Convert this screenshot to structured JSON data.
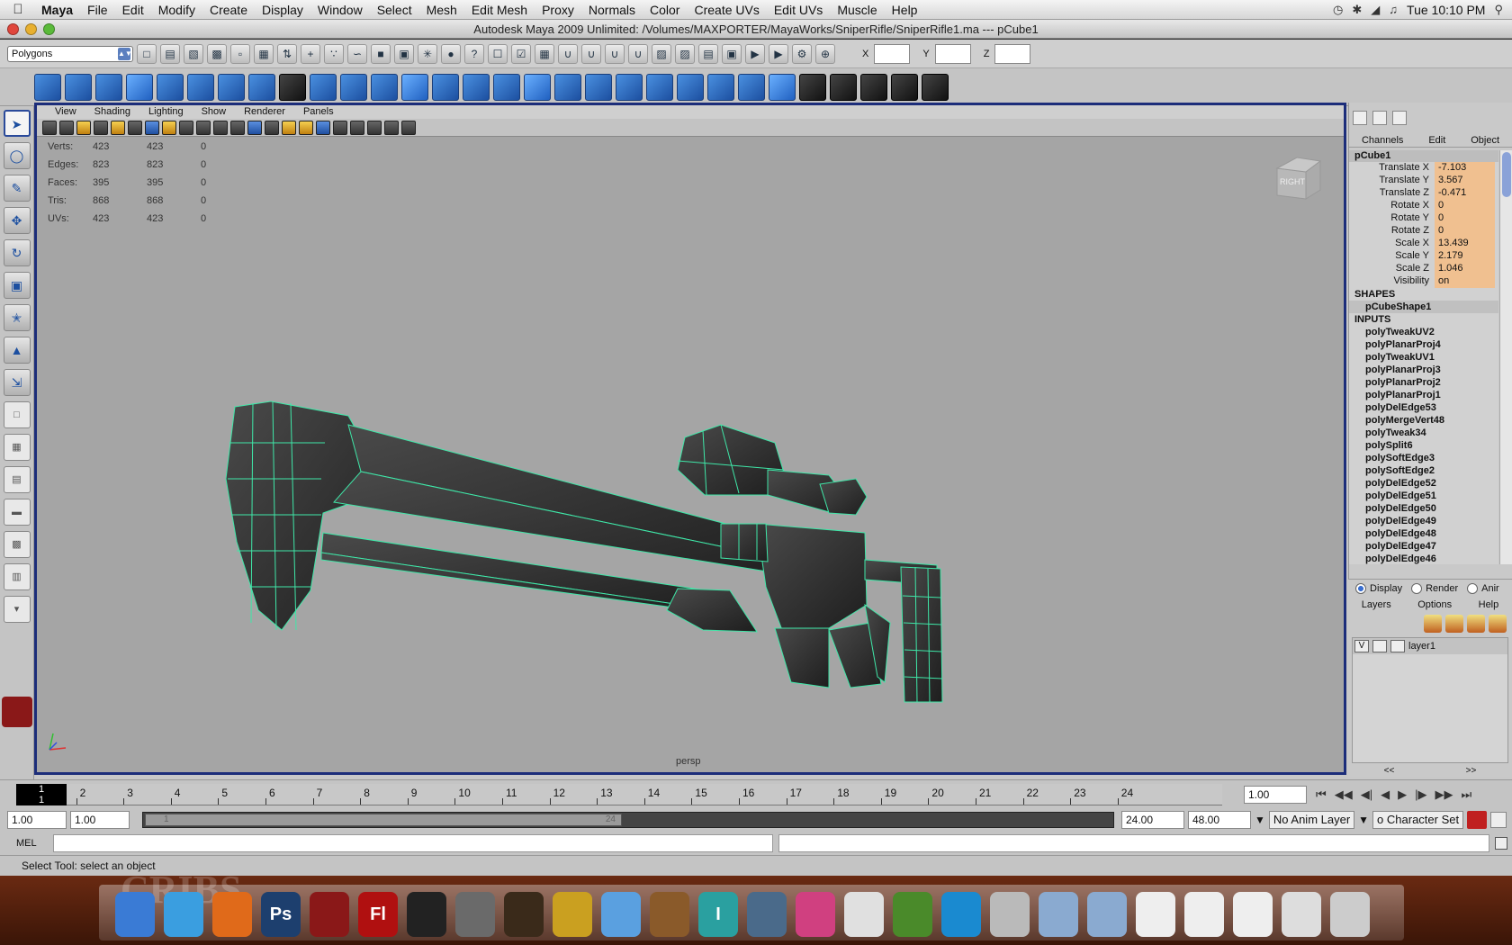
{
  "menubar": {
    "app": "Maya",
    "items": [
      "File",
      "Edit",
      "Modify",
      "Create",
      "Display",
      "Window",
      "Select",
      "Mesh",
      "Edit Mesh",
      "Proxy",
      "Normals",
      "Color",
      "Create UVs",
      "Edit UVs",
      "Muscle",
      "Help"
    ],
    "clock": "Tue 10:10 PM"
  },
  "window": {
    "title": "Autodesk Maya 2009 Unlimited: /Volumes/MAXPORTER/MayaWorks/SniperRifle/SniperRifle1.ma  ---  pCube1"
  },
  "shelf": {
    "mode": "Polygons",
    "x_label": "X",
    "y_label": "Y",
    "z_label": "Z"
  },
  "panel": {
    "menus": [
      "View",
      "Shading",
      "Lighting",
      "Show",
      "Renderer",
      "Panels"
    ],
    "camera": "persp",
    "viewcube_face": "RIGHT"
  },
  "hud": {
    "rows": [
      {
        "label": "Verts:",
        "a": "423",
        "b": "423",
        "c": "0"
      },
      {
        "label": "Edges:",
        "a": "823",
        "b": "823",
        "c": "0"
      },
      {
        "label": "Faces:",
        "a": "395",
        "b": "395",
        "c": "0"
      },
      {
        "label": "Tris:",
        "a": "868",
        "b": "868",
        "c": "0"
      },
      {
        "label": "UVs:",
        "a": "423",
        "b": "423",
        "c": "0"
      }
    ]
  },
  "channelbox": {
    "tabs": [
      "Channels",
      "Edit",
      "Object"
    ],
    "node": "pCube1",
    "attrs": [
      {
        "name": "Translate X",
        "value": "-7.103"
      },
      {
        "name": "Translate Y",
        "value": "3.567"
      },
      {
        "name": "Translate Z",
        "value": "-0.471"
      },
      {
        "name": "Rotate X",
        "value": "0"
      },
      {
        "name": "Rotate Y",
        "value": "0"
      },
      {
        "name": "Rotate Z",
        "value": "0"
      },
      {
        "name": "Scale X",
        "value": "13.439"
      },
      {
        "name": "Scale Y",
        "value": "2.179"
      },
      {
        "name": "Scale Z",
        "value": "1.046"
      },
      {
        "name": "Visibility",
        "value": "on"
      }
    ],
    "shapes_label": "SHAPES",
    "shape": "pCubeShape1",
    "inputs_label": "INPUTS",
    "inputs": [
      "polyTweakUV2",
      "polyPlanarProj4",
      "polyTweakUV1",
      "polyPlanarProj3",
      "polyPlanarProj2",
      "polyPlanarProj1",
      "polyDelEdge53",
      "polyMergeVert48",
      "polyTweak34",
      "polySplit6",
      "polySoftEdge3",
      "polySoftEdge2",
      "polyDelEdge52",
      "polyDelEdge51",
      "polyDelEdge50",
      "polyDelEdge49",
      "polyDelEdge48",
      "polyDelEdge47",
      "polyDelEdge46"
    ]
  },
  "layers": {
    "radio": [
      "Display",
      "Render",
      "Anir"
    ],
    "menus": [
      "Layers",
      "Options",
      "Help"
    ],
    "layer_name": "layer1",
    "vis": "V",
    "nav_left": "<<",
    "nav_right": ">>"
  },
  "time": {
    "current": "1",
    "ticks": [
      "1",
      "2",
      "3",
      "4",
      "5",
      "6",
      "7",
      "8",
      "9",
      "10",
      "11",
      "12",
      "13",
      "14",
      "15",
      "16",
      "17",
      "18",
      "19",
      "20",
      "21",
      "22",
      "23",
      "24"
    ],
    "current_field": "1.00",
    "start": "1.00",
    "start2": "1.00",
    "range_start": "1",
    "range_end": "24",
    "end": "24.00",
    "end2": "48.00",
    "anim_layer": "No Anim Layer",
    "char_set": "o Character Set"
  },
  "cmd": {
    "label": "MEL"
  },
  "help": {
    "text": "Select Tool: select an object"
  },
  "dock": {
    "bg_text": "CRIBS",
    "icons": [
      {
        "name": "finder",
        "label": "",
        "color": "#3a7bd5"
      },
      {
        "name": "safari",
        "label": "",
        "color": "#3a9ee0"
      },
      {
        "name": "firefox",
        "label": "",
        "color": "#e06a1a"
      },
      {
        "name": "photoshop",
        "label": "Ps",
        "color": "#1d3f6e"
      },
      {
        "name": "maya",
        "label": "",
        "color": "#8a1818"
      },
      {
        "name": "flash",
        "label": "Fl",
        "color": "#b01010"
      },
      {
        "name": "unity",
        "label": "",
        "color": "#222222"
      },
      {
        "name": "script-editor",
        "label": "",
        "color": "#6a6a6a"
      },
      {
        "name": "warcraft",
        "label": "",
        "color": "#3a2a1a"
      },
      {
        "name": "imovie",
        "label": "",
        "color": "#caa020"
      },
      {
        "name": "itunes",
        "label": "",
        "color": "#5aa0e0"
      },
      {
        "name": "garageband",
        "label": "",
        "color": "#8a5a2a"
      },
      {
        "name": "textedit",
        "label": "I",
        "color": "#2aa0a0"
      },
      {
        "name": "iphoto",
        "label": "",
        "color": "#4a6a8a"
      },
      {
        "name": "color-wheel",
        "label": "",
        "color": "#d04080"
      },
      {
        "name": "preview",
        "label": "",
        "color": "#e0e0e0"
      },
      {
        "name": "lotus",
        "label": "",
        "color": "#4a8a2a"
      },
      {
        "name": "quicktime",
        "label": "",
        "color": "#1a8ad0"
      },
      {
        "name": "mail",
        "label": "",
        "color": "#bababa"
      },
      {
        "name": "applications-folder",
        "label": "",
        "color": "#8aaad0"
      },
      {
        "name": "documents-folder",
        "label": "",
        "color": "#8aaad0"
      },
      {
        "name": "doc-stack",
        "label": "",
        "color": "#eeeeee"
      },
      {
        "name": "doc-stack-2",
        "label": "",
        "color": "#eeeeee"
      },
      {
        "name": "doc-stack-3",
        "label": "",
        "color": "#eeeeee"
      },
      {
        "name": "doc-stack-4",
        "label": "",
        "color": "#dddddd"
      },
      {
        "name": "trash",
        "label": "",
        "color": "#cccccc"
      }
    ]
  }
}
